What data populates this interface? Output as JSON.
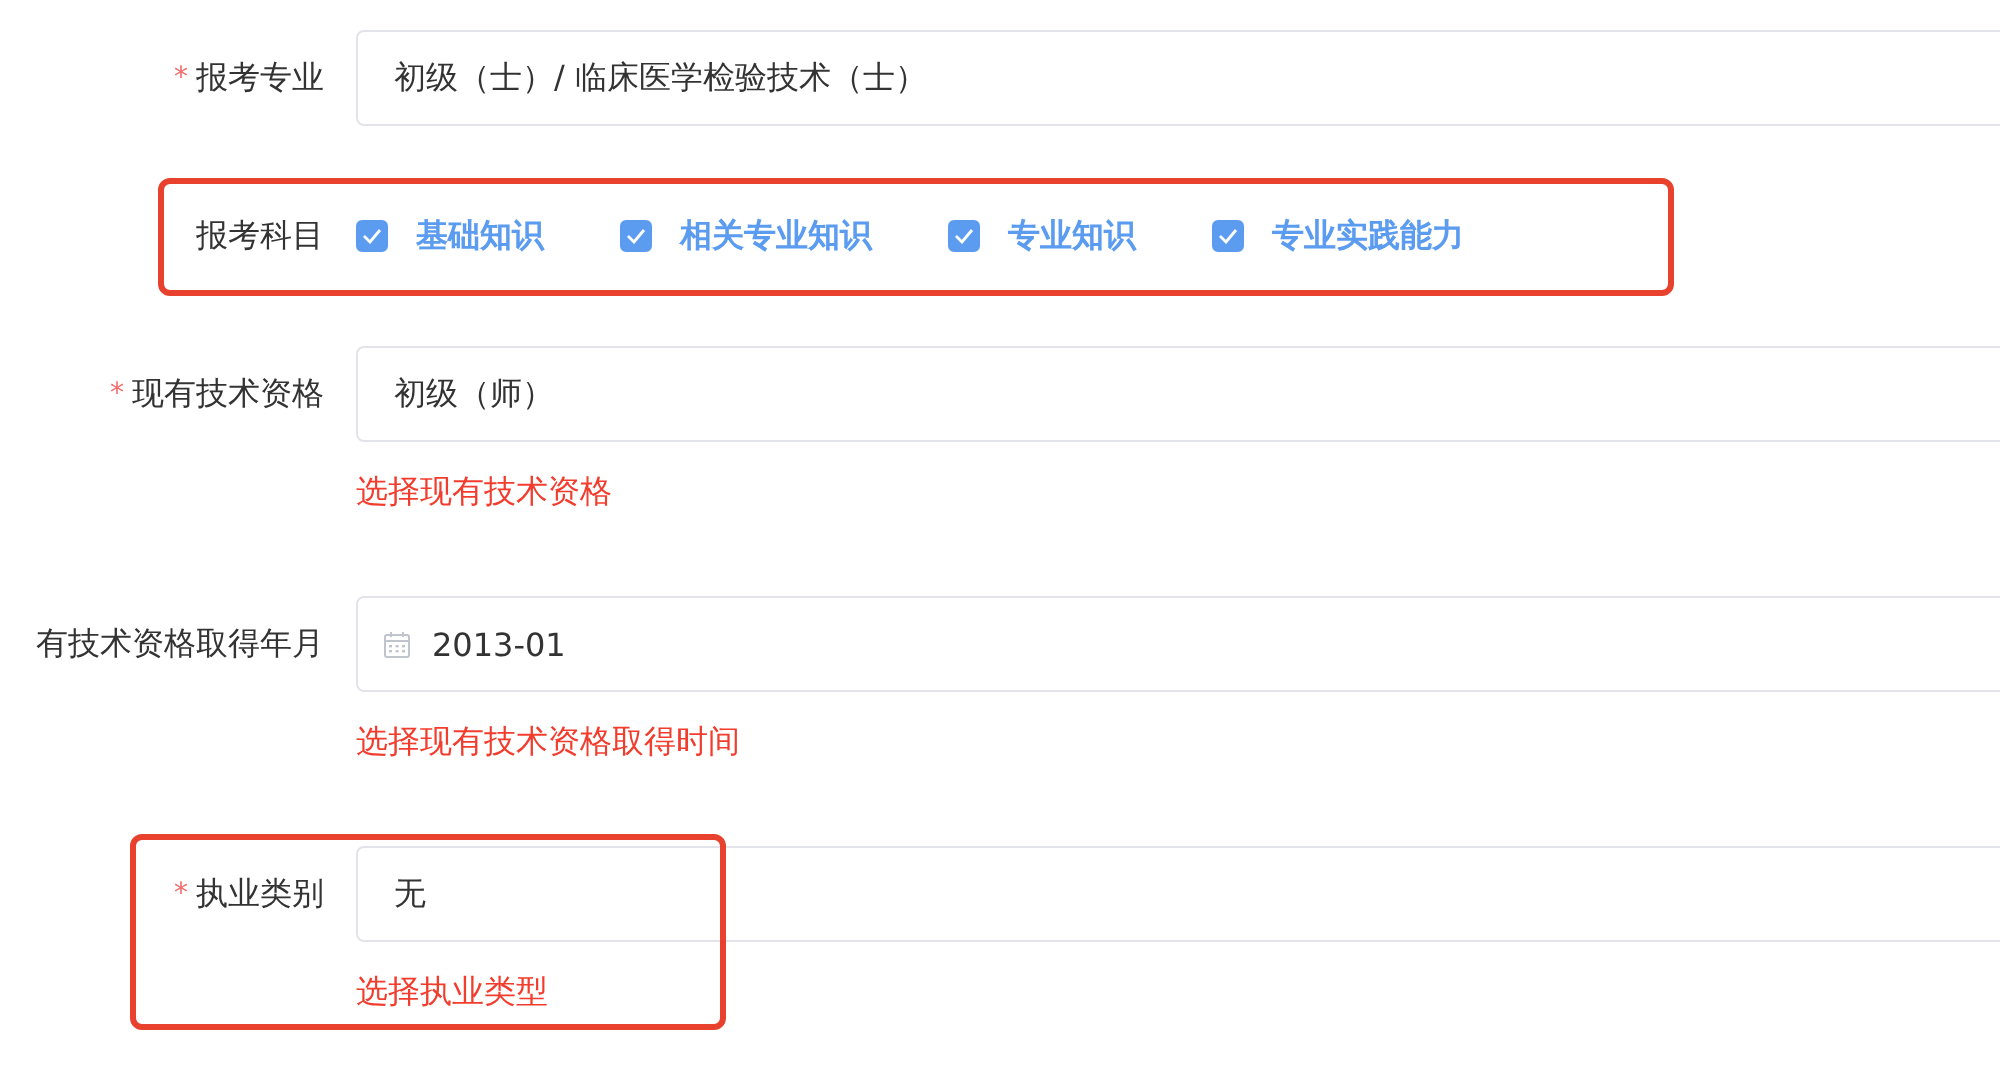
{
  "fields": [
    {
      "kind": "text",
      "label": "报考专业",
      "required_mark": "*",
      "value": "初级（士）/ 临床医学检验技术（士）"
    },
    {
      "kind": "checkboxes",
      "label": "报考科目",
      "highlighted": true,
      "options": [
        {
          "label": "基础知识",
          "checked": true
        },
        {
          "label": "相关专业知识",
          "checked": true
        },
        {
          "label": "专业知识",
          "checked": true
        },
        {
          "label": "专业实践能力",
          "checked": true
        }
      ]
    },
    {
      "kind": "text",
      "label": "现有技术资格",
      "required_mark": "*",
      "value": "初级（师）",
      "error": "选择现有技术资格"
    },
    {
      "kind": "date",
      "label": "有技术资格取得年月",
      "value": "2013-01",
      "error": "选择现有技术资格取得时间"
    },
    {
      "kind": "text",
      "label": "执业类别",
      "required_mark": "*",
      "highlighted": true,
      "value": "无",
      "error": "选择执业类型"
    }
  ]
}
